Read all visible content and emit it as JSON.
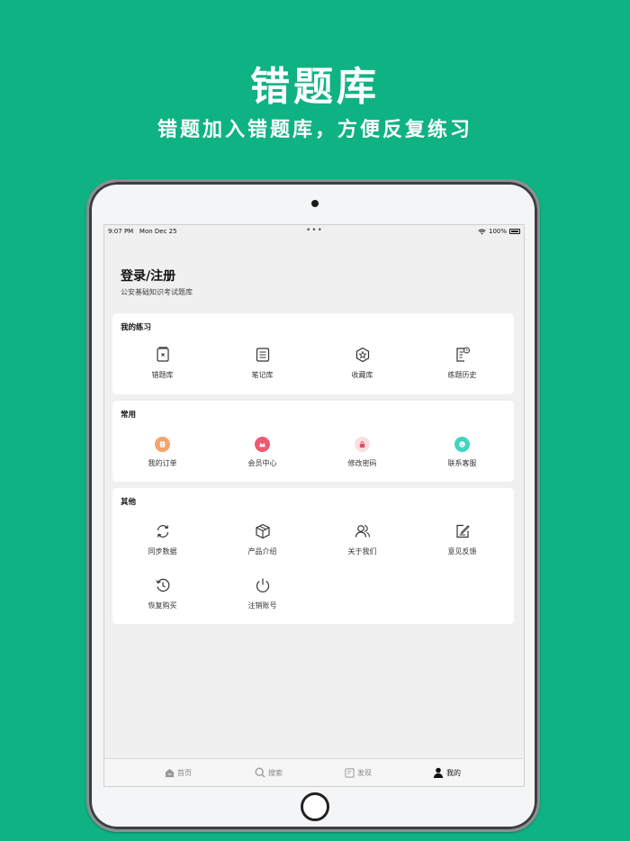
{
  "promo": {
    "title": "错题库",
    "subtitle": "错题加入错题库，方便反复练习"
  },
  "status_bar": {
    "time": "9:07 PM",
    "date": "Mon Dec 25",
    "battery": "100%"
  },
  "header": {
    "login": "登录/注册",
    "app_name": "公安基础知识考试题库"
  },
  "sections": {
    "practice": {
      "title": "我的练习",
      "items": [
        {
          "label": "错题库",
          "icon": "wrong-book-icon"
        },
        {
          "label": "笔记库",
          "icon": "notes-icon"
        },
        {
          "label": "收藏库",
          "icon": "favorite-icon"
        },
        {
          "label": "练题历史",
          "icon": "history-icon"
        }
      ]
    },
    "common": {
      "title": "常用",
      "items": [
        {
          "label": "我的订单",
          "icon": "order-icon",
          "color": "#f4a46b"
        },
        {
          "label": "会员中心",
          "icon": "vip-icon",
          "color": "#ef5a73"
        },
        {
          "label": "修改密码",
          "icon": "lock-icon",
          "color": "#f9dfe2"
        },
        {
          "label": "联系客服",
          "icon": "service-icon",
          "color": "#3fd6c0"
        }
      ]
    },
    "other": {
      "title": "其他",
      "items": [
        {
          "label": "同步数据",
          "icon": "sync-icon"
        },
        {
          "label": "产品介绍",
          "icon": "box-icon"
        },
        {
          "label": "关于我们",
          "icon": "users-icon"
        },
        {
          "label": "意见反馈",
          "icon": "feedback-icon"
        },
        {
          "label": "恢复购买",
          "icon": "restore-icon"
        },
        {
          "label": "注销账号",
          "icon": "power-icon"
        }
      ]
    }
  },
  "tabs": [
    {
      "label": "首页",
      "icon": "home-icon"
    },
    {
      "label": "搜索",
      "icon": "search-icon"
    },
    {
      "label": "发现",
      "icon": "discover-icon"
    },
    {
      "label": "我的",
      "icon": "profile-icon",
      "active": true
    }
  ]
}
